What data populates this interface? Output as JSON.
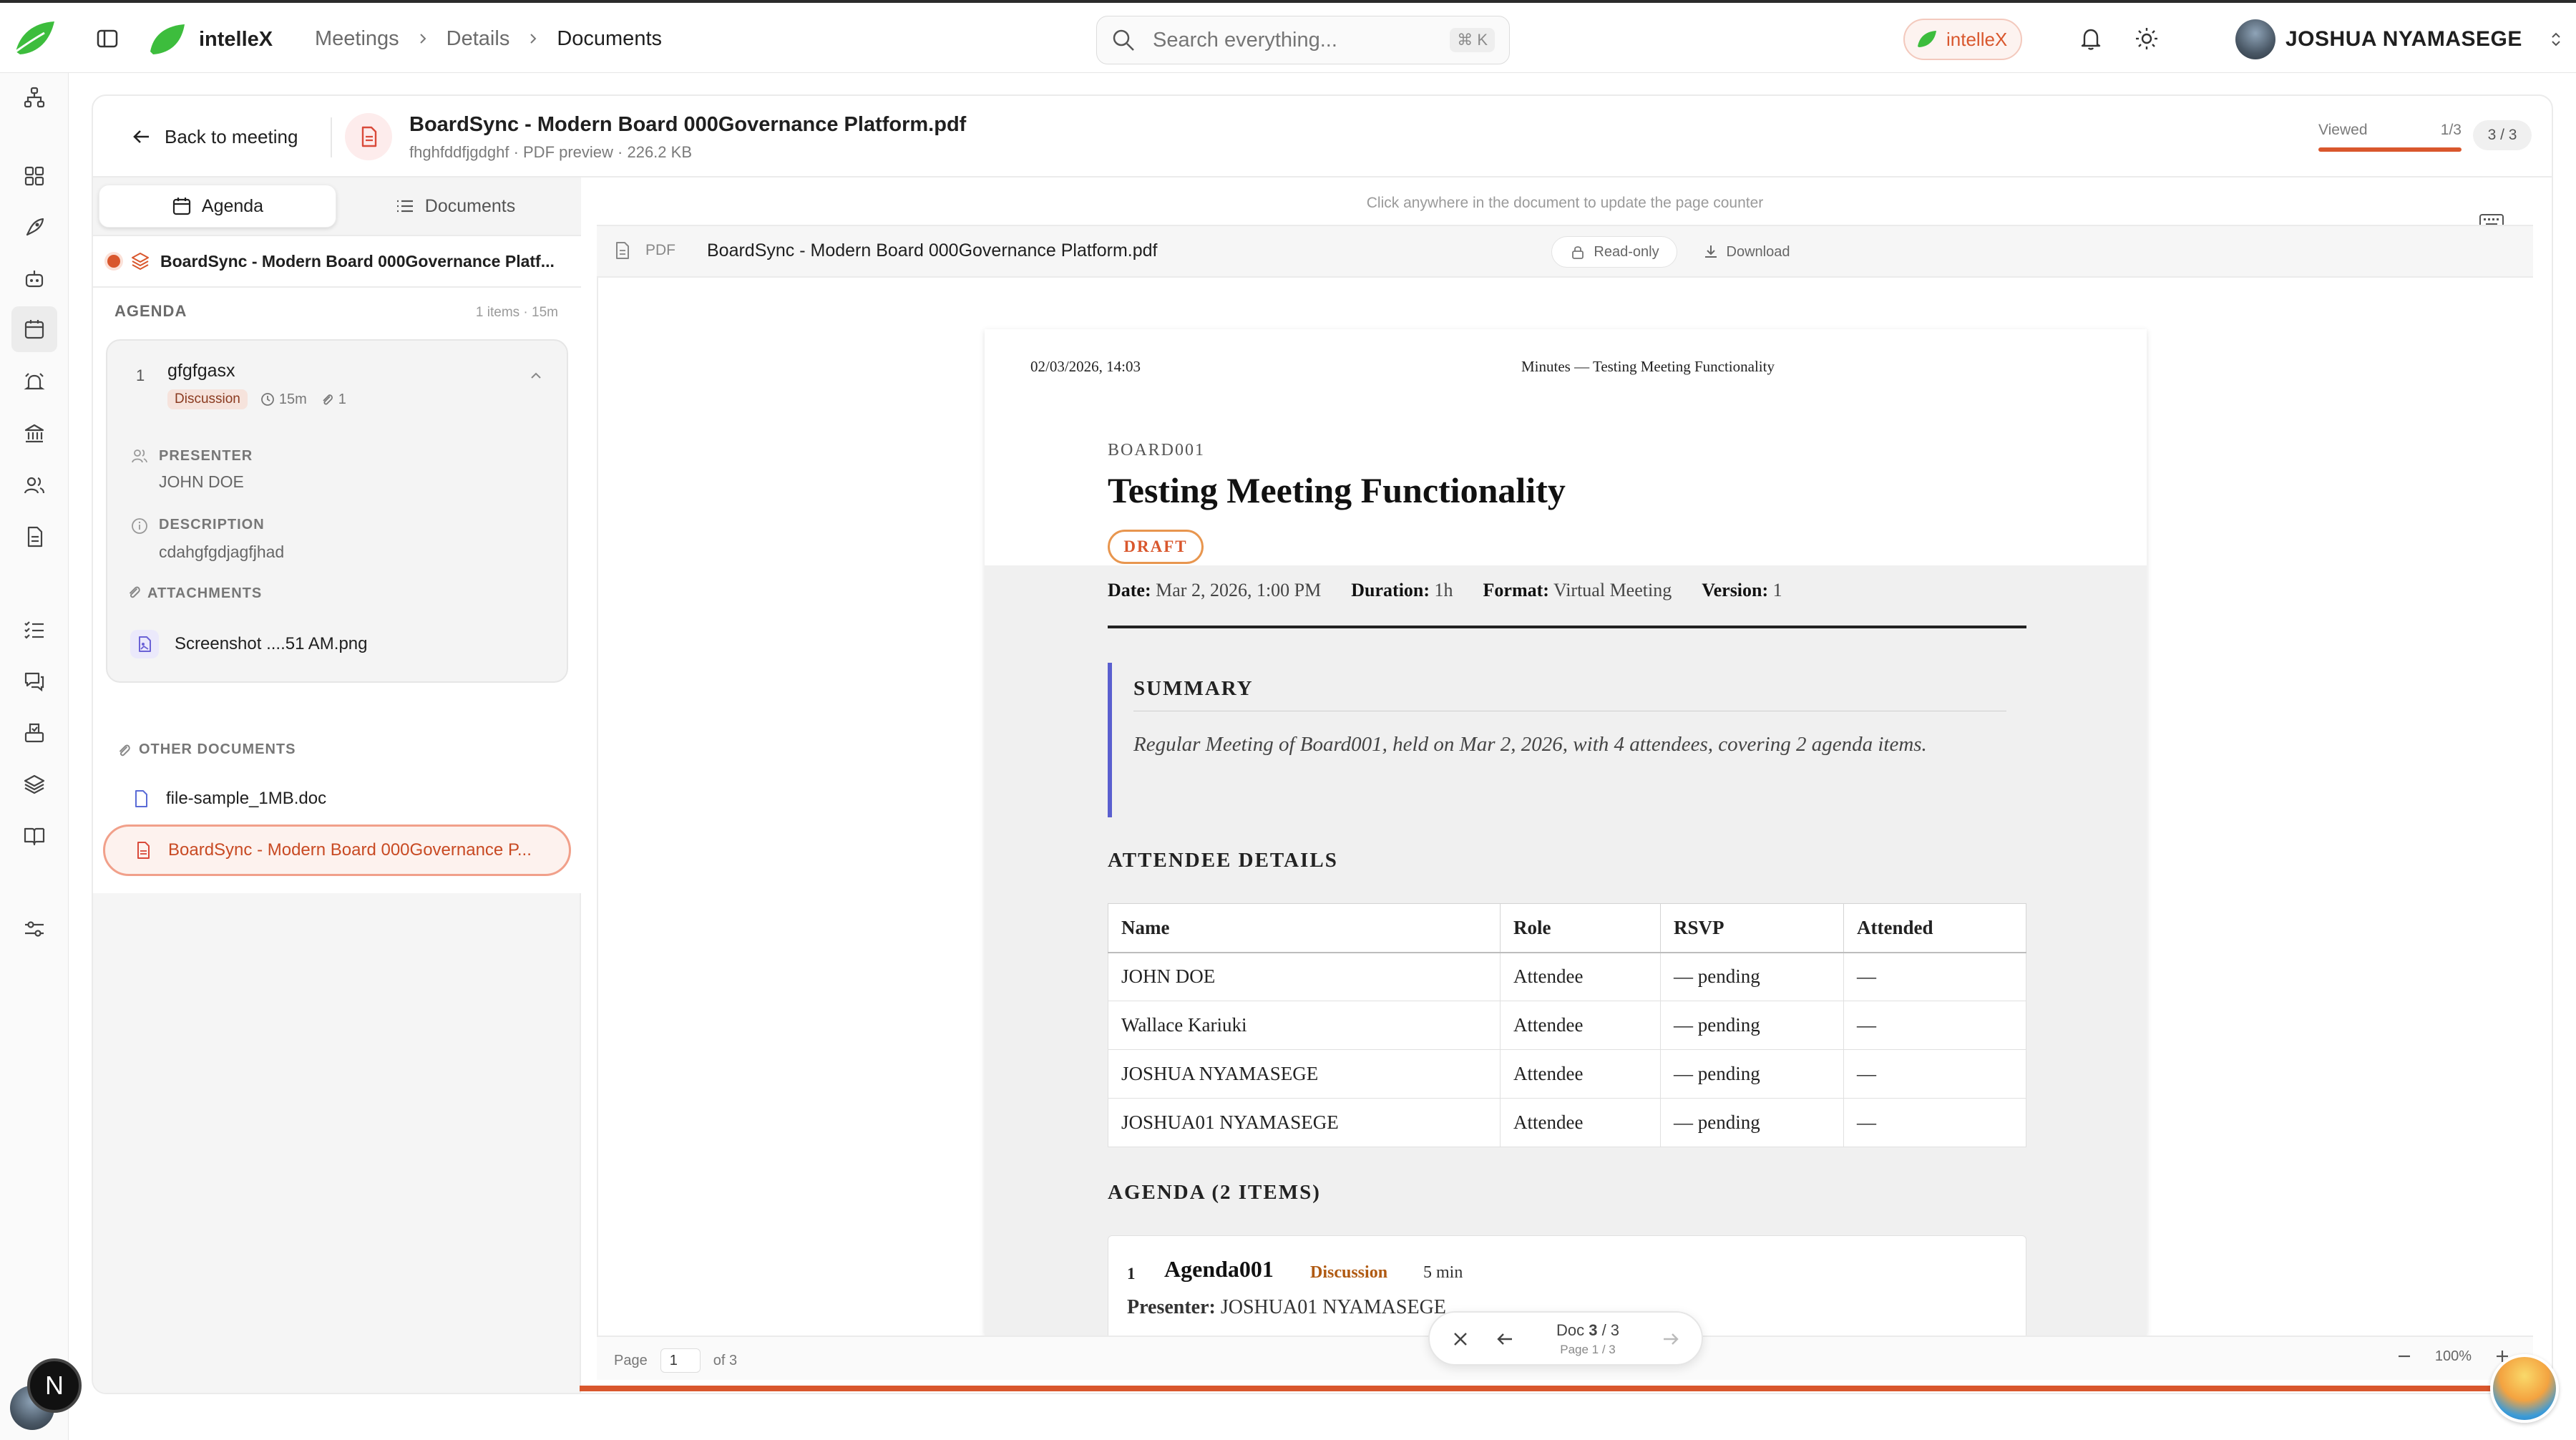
{
  "app": {
    "brand": "intelleX",
    "breadcrumbs": [
      "Meetings",
      "Details",
      "Documents"
    ],
    "search_placeholder": "Search everything...",
    "search_shortcut": "⌘ K",
    "brand_pill": "intelleX",
    "user_name": "JOSHUA NYAMASEGE",
    "n_badge": "N"
  },
  "header": {
    "back_label": "Back to meeting",
    "doc_title": "BoardSync - Modern Board 000Governance Platform.pdf",
    "doc_meta": "fhghfddfjgdghf · PDF preview · 226.2 KB",
    "viewed_label": "Viewed",
    "viewed_count": "1/3",
    "viewed_progress": 1.0,
    "counter": "3 / 3"
  },
  "sidebar": {
    "tabs": [
      "Agenda",
      "Documents"
    ],
    "active_tab": "Agenda",
    "current_doc": "BoardSync - Modern Board 000Governance Platf...",
    "agenda_header": "AGENDA",
    "agenda_count": "1 items · 15m",
    "agenda_item": {
      "number": "1",
      "title": "gfgfgasx",
      "tag": "Discussion",
      "duration": "15m",
      "attachments": "1",
      "presenter_label": "PRESENTER",
      "presenter": "JOHN DOE",
      "description_label": "DESCRIPTION",
      "description": "cdahgfgdjagfjhad",
      "attachments_label": "ATTACHMENTS",
      "attachment_name": "Screenshot ....51 AM.png"
    },
    "other_docs_header": "OTHER DOCUMENTS",
    "other_docs": [
      "file-sample_1MB.doc",
      "BoardSync - Modern Board 000Governance P..."
    ]
  },
  "viewer": {
    "hint": "Click anywhere in the document to update the page counter",
    "pdf_label": "PDF",
    "file_name": "BoardSync - Modern Board 000Governance Platform.pdf",
    "readonly_label": "Read-only",
    "download_label": "Download",
    "footer_page_label": "Page",
    "footer_page_value": "1",
    "footer_of": "of 3",
    "zoom": "100%",
    "nav_doc_prefix": "Doc ",
    "nav_doc_current": "3",
    "nav_doc_total": " / 3",
    "nav_page": "Page 1 / 3"
  },
  "pdf": {
    "timestamp": "02/03/2026, 14:03",
    "running_head": "Minutes — Testing Meeting Functionality",
    "board": "BOARD001",
    "title": "Testing Meeting Functionality",
    "status": "DRAFT",
    "meta": {
      "date_label": "Date:",
      "date": "Mar 2, 2026, 1:00 PM",
      "duration_label": "Duration:",
      "duration": "1h",
      "format_label": "Format:",
      "format": "Virtual Meeting",
      "version_label": "Version:",
      "version": "1"
    },
    "summary_heading": "SUMMARY",
    "summary_text": "Regular Meeting of Board001, held on Mar 2, 2026, with 4 attendees, covering 2 agenda items.",
    "attendee_heading": "ATTENDEE DETAILS",
    "attendee_columns": [
      "Name",
      "Role",
      "RSVP",
      "Attended"
    ],
    "attendees": [
      [
        "JOHN DOE",
        "Attendee",
        "— pending",
        "—"
      ],
      [
        "Wallace Kariuki",
        "Attendee",
        "— pending",
        "—"
      ],
      [
        "JOSHUA NYAMASEGE",
        "Attendee",
        "— pending",
        "—"
      ],
      [
        "JOSHUA01 NYAMASEGE",
        "Attendee",
        "— pending",
        "—"
      ]
    ],
    "agenda_heading": "AGENDA (2 ITEMS)",
    "agenda_item": {
      "number": "1",
      "title": "Agenda001",
      "tag": "Discussion",
      "duration": "5 min",
      "presenter_label": "Presenter:",
      "presenter": "JOSHUA01 NYAMASEGE"
    }
  },
  "colors": {
    "accent": "#d9572d",
    "brand_green": "#3dbd3d",
    "summary_bar": "#5a5fcf"
  }
}
